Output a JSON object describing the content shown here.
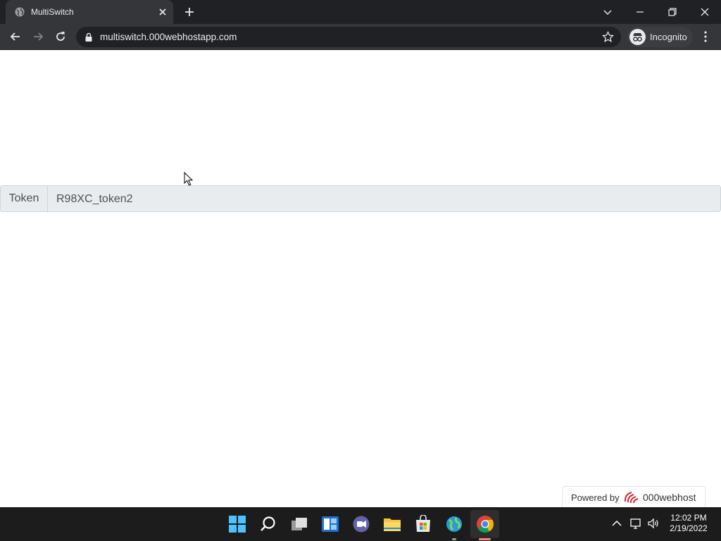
{
  "browser": {
    "tab_title": "MultiSwitch",
    "url": "multiswitch.000webhostapp.com",
    "incognito_label": "Incognito"
  },
  "page": {
    "token_label": "Token",
    "token_value": "R98XC_token2"
  },
  "footer": {
    "powered_by": "Powered by",
    "host_name": "000webhost"
  },
  "taskbar": {
    "time": "12:02 PM",
    "date": "2/19/2022",
    "icons": [
      "windows-start-icon",
      "search-icon",
      "task-view-icon",
      "widgets-icon",
      "teams-chat-icon",
      "file-explorer-icon",
      "microsoft-store-icon",
      "globe-app-icon",
      "chrome-icon"
    ]
  }
}
